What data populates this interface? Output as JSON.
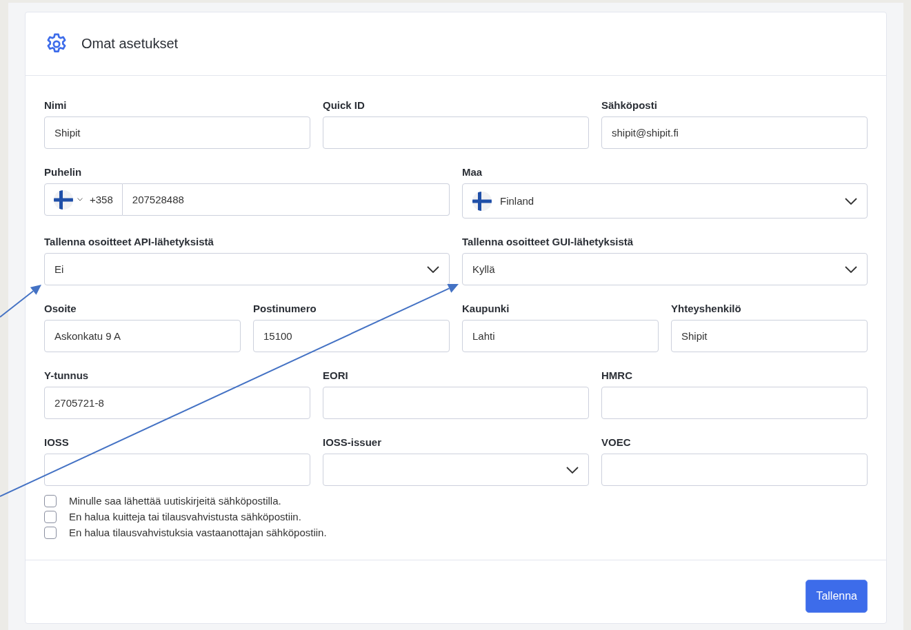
{
  "header": {
    "title": "Omat asetukset"
  },
  "rows": [
    {
      "fields": [
        {
          "kind": "text",
          "label": "Nimi",
          "value": "Shipit"
        },
        {
          "kind": "text",
          "label": "Quick ID"
        },
        {
          "kind": "text",
          "label": "Sähköposti",
          "value": "shipit@shipit.fi"
        }
      ]
    },
    {
      "fields": [
        {
          "kind": "phone",
          "label": "Puhelin",
          "country_code": "+358",
          "value": "207528488"
        },
        {
          "kind": "country",
          "label": "Maa",
          "value": "Finland"
        }
      ]
    },
    {
      "fields": [
        {
          "kind": "select",
          "label": "Tallenna osoitteet API-lähetyksistä",
          "value": "Ei"
        },
        {
          "kind": "select",
          "label": "Tallenna osoitteet GUI-lähetyksistä",
          "value": "Kyllä"
        }
      ]
    },
    {
      "fields": [
        {
          "kind": "text",
          "label": "Osoite",
          "value": "Askonkatu 9 A"
        },
        {
          "kind": "text",
          "label": "Postinumero",
          "value": "15100"
        },
        {
          "kind": "text",
          "label": "Kaupunki",
          "value": "Lahti"
        },
        {
          "kind": "text",
          "label": "Yhteyshenkilö",
          "value": "Shipit"
        }
      ]
    },
    {
      "fields": [
        {
          "kind": "text",
          "label": "Y-tunnus",
          "value": "2705721-8"
        },
        {
          "kind": "text",
          "label": "EORI"
        },
        {
          "kind": "text",
          "label": "HMRC"
        }
      ]
    },
    {
      "fields": [
        {
          "kind": "text",
          "label": "IOSS"
        },
        {
          "kind": "select",
          "label": "IOSS-issuer"
        },
        {
          "kind": "text",
          "label": "VOEC"
        }
      ]
    }
  ],
  "checkboxes": [
    {
      "label": "Minulle saa lähettää uutiskirjeitä sähköpostilla.",
      "checked": false
    },
    {
      "label": "En halua kuitteja tai tilausvahvistusta sähköpostiin.",
      "checked": false
    },
    {
      "label": "En halua tilausvahvistuksia vastaanottajan sähköpostiin.",
      "checked": false
    }
  ],
  "save_button": "Tallenna"
}
